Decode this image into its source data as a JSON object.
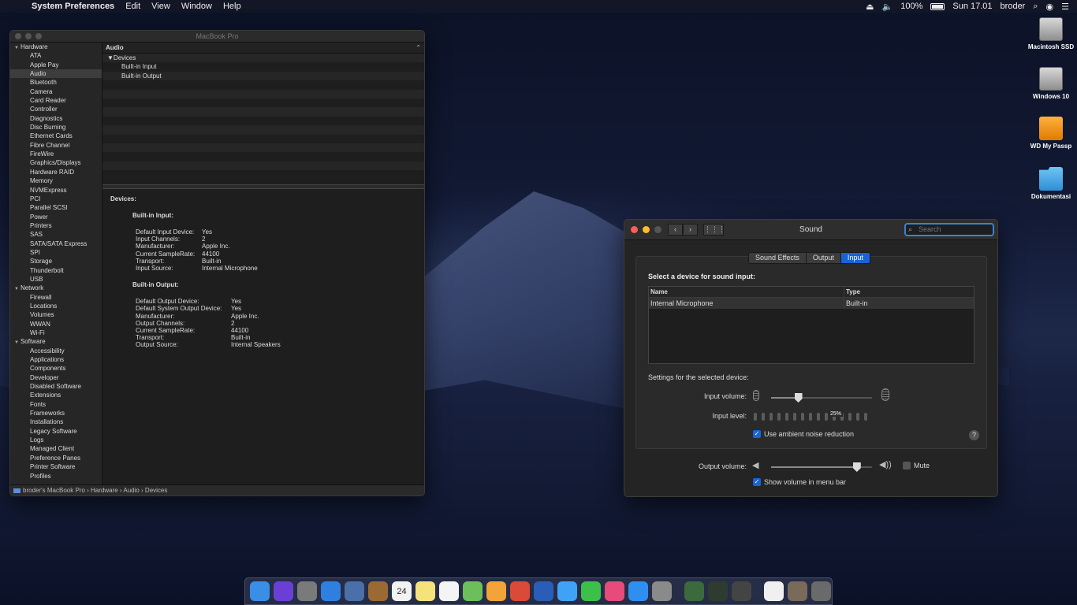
{
  "menubar": {
    "app": "System Preferences",
    "items": [
      "Edit",
      "View",
      "Window",
      "Help"
    ],
    "battery": "100%",
    "clock": "Sun 17.01",
    "user": "broder"
  },
  "desktop": {
    "icons": [
      {
        "label": "Macintosh SSD",
        "kind": "hdd-icon"
      },
      {
        "label": "Windows 10",
        "kind": "hdd-icon"
      },
      {
        "label": "WD My Passp",
        "kind": "external-drive-icon"
      },
      {
        "label": "Dokumentasi",
        "kind": "folder-icon"
      }
    ]
  },
  "sysinfo": {
    "title": "MacBook Pro",
    "sidebar": [
      {
        "type": "group",
        "label": "Hardware"
      },
      {
        "type": "item",
        "label": "ATA"
      },
      {
        "type": "item",
        "label": "Apple Pay"
      },
      {
        "type": "item",
        "label": "Audio",
        "selected": true
      },
      {
        "type": "item",
        "label": "Bluetooth"
      },
      {
        "type": "item",
        "label": "Camera"
      },
      {
        "type": "item",
        "label": "Card Reader"
      },
      {
        "type": "item",
        "label": "Controller"
      },
      {
        "type": "item",
        "label": "Diagnostics"
      },
      {
        "type": "item",
        "label": "Disc Burning"
      },
      {
        "type": "item",
        "label": "Ethernet Cards"
      },
      {
        "type": "item",
        "label": "Fibre Channel"
      },
      {
        "type": "item",
        "label": "FireWire"
      },
      {
        "type": "item",
        "label": "Graphics/Displays"
      },
      {
        "type": "item",
        "label": "Hardware RAID"
      },
      {
        "type": "item",
        "label": "Memory"
      },
      {
        "type": "item",
        "label": "NVMExpress"
      },
      {
        "type": "item",
        "label": "PCI"
      },
      {
        "type": "item",
        "label": "Parallel SCSI"
      },
      {
        "type": "item",
        "label": "Power"
      },
      {
        "type": "item",
        "label": "Printers"
      },
      {
        "type": "item",
        "label": "SAS"
      },
      {
        "type": "item",
        "label": "SATA/SATA Express"
      },
      {
        "type": "item",
        "label": "SPI"
      },
      {
        "type": "item",
        "label": "Storage"
      },
      {
        "type": "item",
        "label": "Thunderbolt"
      },
      {
        "type": "item",
        "label": "USB"
      },
      {
        "type": "group",
        "label": "Network"
      },
      {
        "type": "item",
        "label": "Firewall"
      },
      {
        "type": "item",
        "label": "Locations"
      },
      {
        "type": "item",
        "label": "Volumes"
      },
      {
        "type": "item",
        "label": "WWAN"
      },
      {
        "type": "item",
        "label": "Wi-Fi"
      },
      {
        "type": "group",
        "label": "Software"
      },
      {
        "type": "item",
        "label": "Accessibility"
      },
      {
        "type": "item",
        "label": "Applications"
      },
      {
        "type": "item",
        "label": "Components"
      },
      {
        "type": "item",
        "label": "Developer"
      },
      {
        "type": "item",
        "label": "Disabled Software"
      },
      {
        "type": "item",
        "label": "Extensions"
      },
      {
        "type": "item",
        "label": "Fonts"
      },
      {
        "type": "item",
        "label": "Frameworks"
      },
      {
        "type": "item",
        "label": "Installations"
      },
      {
        "type": "item",
        "label": "Legacy Software"
      },
      {
        "type": "item",
        "label": "Logs"
      },
      {
        "type": "item",
        "label": "Managed Client"
      },
      {
        "type": "item",
        "label": "Preference Panes"
      },
      {
        "type": "item",
        "label": "Printer Software"
      },
      {
        "type": "item",
        "label": "Profiles"
      }
    ],
    "section_title": "Audio",
    "tree": [
      {
        "label": "▼Devices",
        "indent": 1
      },
      {
        "label": "Built-in Input",
        "indent": 2
      },
      {
        "label": "Built-in Output",
        "indent": 2
      }
    ],
    "detail": {
      "heading": "Devices:",
      "input_heading": "Built-in Input:",
      "input": [
        [
          "Default Input Device:",
          "Yes"
        ],
        [
          "Input Channels:",
          "2"
        ],
        [
          "Manufacturer:",
          "Apple Inc."
        ],
        [
          "Current SampleRate:",
          "44100"
        ],
        [
          "Transport:",
          "Built-in"
        ],
        [
          "Input Source:",
          "Internal Microphone"
        ]
      ],
      "output_heading": "Built-in Output:",
      "output": [
        [
          "Default Output Device:",
          "Yes"
        ],
        [
          "Default System Output Device:",
          "Yes"
        ],
        [
          "Manufacturer:",
          "Apple Inc."
        ],
        [
          "Output Channels:",
          "2"
        ],
        [
          "Current SampleRate:",
          "44100"
        ],
        [
          "Transport:",
          "Built-in"
        ],
        [
          "Output Source:",
          "Internal Speakers"
        ]
      ]
    },
    "path": [
      "broder's MacBook Pro",
      "Hardware",
      "Audio",
      "Devices"
    ]
  },
  "sound": {
    "title": "Sound",
    "search_placeholder": "Search",
    "tabs": [
      {
        "label": "Sound Effects",
        "active": false
      },
      {
        "label": "Output",
        "active": false
      },
      {
        "label": "Input",
        "active": true
      }
    ],
    "select_label": "Select a device for sound input:",
    "table_headers": [
      "Name",
      "Type"
    ],
    "devices": [
      [
        "Internal Microphone",
        "Built-in"
      ]
    ],
    "settings_label": "Settings for the selected device:",
    "input_volume_label": "Input volume:",
    "input_volume": 0.27,
    "input_level_label": "Input level:",
    "input_level_tooltip": "25%",
    "ambient_label": "Use ambient noise reduction",
    "ambient_checked": true,
    "output_volume_label": "Output volume:",
    "output_volume": 0.85,
    "mute_label": "Mute",
    "mute_checked": false,
    "show_volume_label": "Show volume in menu bar",
    "show_volume_checked": true
  },
  "dock": {
    "apps": [
      {
        "name": "finder-icon",
        "color": "#3a8ee6"
      },
      {
        "name": "siri-icon",
        "color": "#6b3fd6"
      },
      {
        "name": "launchpad-icon",
        "color": "#7a7a7a"
      },
      {
        "name": "safari-icon",
        "color": "#2f7fe0"
      },
      {
        "name": "preview-icon",
        "color": "#4b6fa8"
      },
      {
        "name": "notebook-icon",
        "color": "#9a6a32"
      },
      {
        "name": "calendar-icon",
        "color": "#f2f2f2"
      },
      {
        "name": "notes-icon",
        "color": "#f6e27a"
      },
      {
        "name": "reminders-icon",
        "color": "#f4f4f4"
      },
      {
        "name": "maps-icon",
        "color": "#6cbf5a"
      },
      {
        "name": "photos-icon",
        "color": "#f2a33a"
      },
      {
        "name": "chrome-icon",
        "color": "#d94a38"
      },
      {
        "name": "keynote-icon",
        "color": "#2a5db8"
      },
      {
        "name": "messages-icon",
        "color": "#3fa2f7"
      },
      {
        "name": "facetime-icon",
        "color": "#3cc04a"
      },
      {
        "name": "itunes-icon",
        "color": "#e64b7b"
      },
      {
        "name": "app-store-icon",
        "color": "#2f8ff0"
      },
      {
        "name": "system-preferences-icon",
        "color": "#8a8a8a"
      },
      {
        "name": "system-information-icon",
        "color": "#3c6a3c"
      },
      {
        "name": "circuit-icon",
        "color": "#2f3b2f"
      },
      {
        "name": "network-utility-icon",
        "color": "#444"
      },
      {
        "name": "document-icon",
        "color": "#f0f0f0"
      },
      {
        "name": "photo-stack-icon",
        "color": "#7a6a5a"
      },
      {
        "name": "trash-icon",
        "color": "#6a6a6a"
      }
    ],
    "calendar_day": "24"
  }
}
